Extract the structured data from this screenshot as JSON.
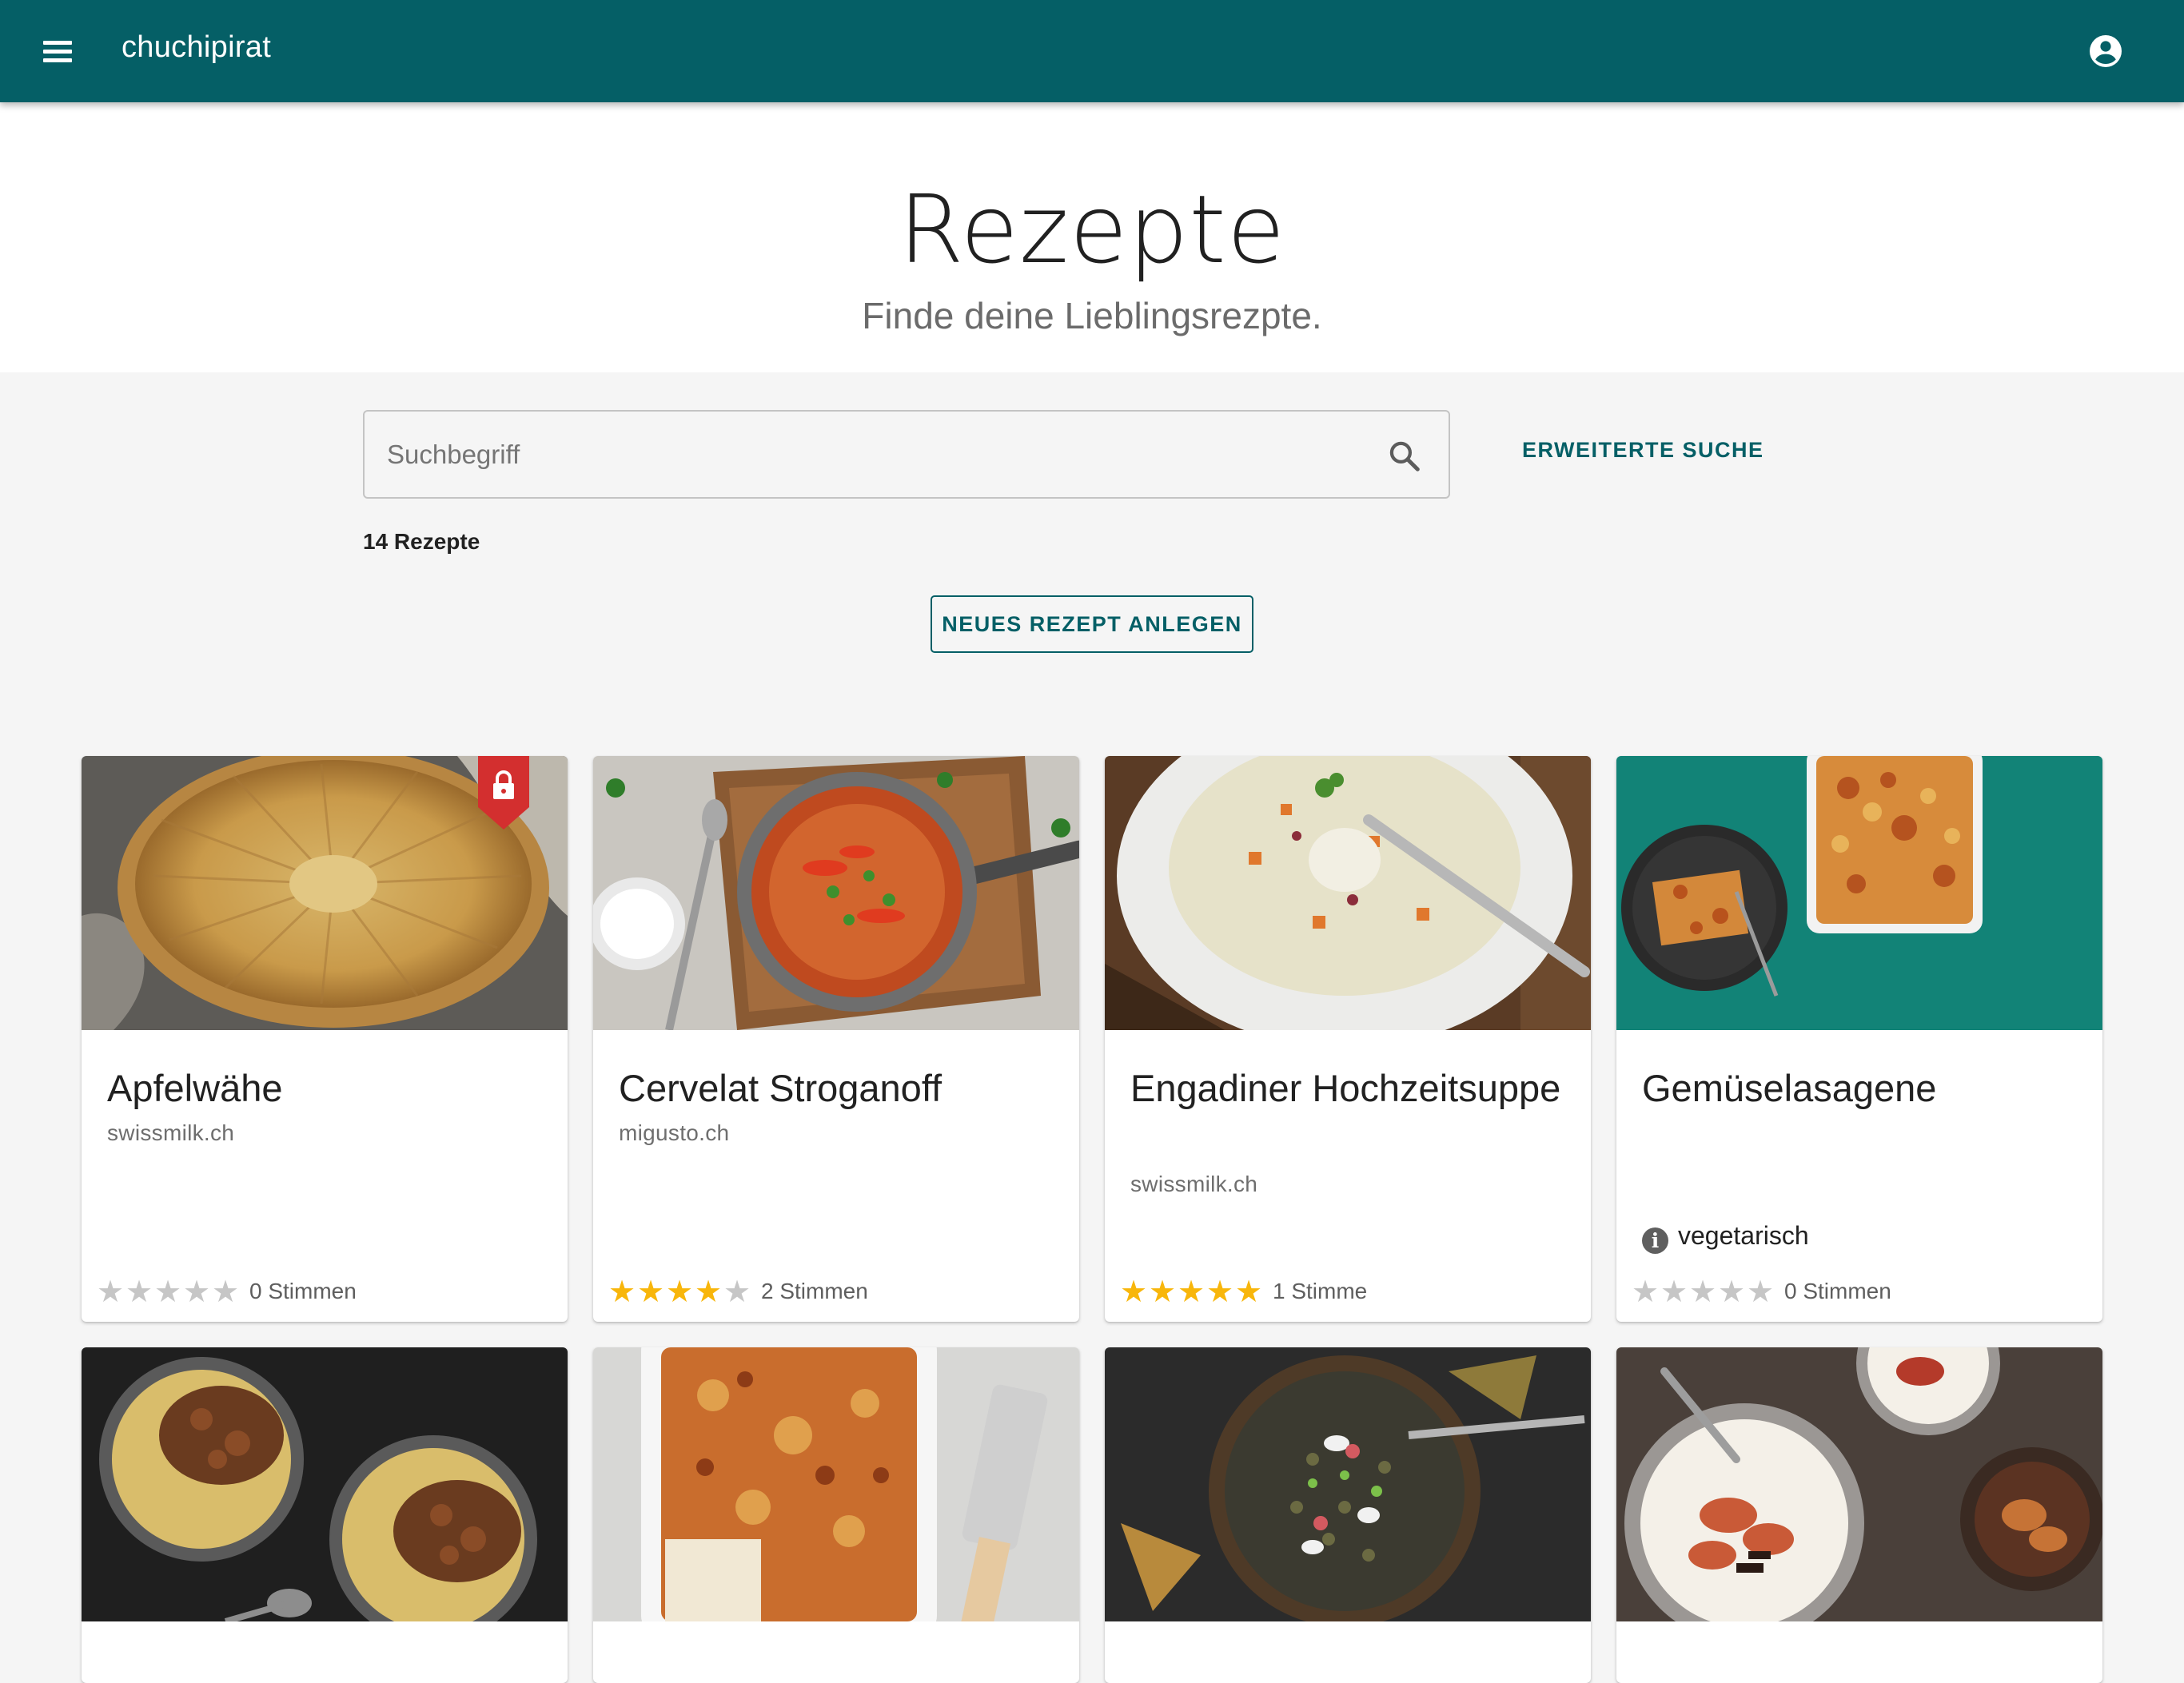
{
  "appbar": {
    "title": "chuchipirat",
    "menu_icon": "menu-icon",
    "account_icon": "account-circle-icon",
    "color": "#055f66"
  },
  "hero": {
    "title": "Rezepte",
    "subtitle": "Finde deine Lieblingsrezpte."
  },
  "search": {
    "placeholder": "Suchbegriff",
    "value": "",
    "icon": "search-icon",
    "advanced_label": "ERWEITERTE SUCHE"
  },
  "results": {
    "count_label": "14 Rezepte"
  },
  "actions": {
    "new_recipe_label": "NEUES REZEPT ANLEGEN"
  },
  "colors": {
    "accent": "#055f66",
    "star_active": "#f8b60b",
    "star_inactive": "#c6c6c6",
    "lock_badge": "#d32f2f"
  },
  "recipes": [
    {
      "title": "Apfelwähe",
      "source": "swissmilk.ch",
      "tag": "",
      "rating": 0,
      "votes_label": "0 Stimmen",
      "private": true,
      "image": "apple-tart"
    },
    {
      "title": "Cervelat Stroganoff",
      "source": "migusto.ch",
      "tag": "",
      "rating": 4,
      "votes_label": "2 Stimmen",
      "private": false,
      "image": "stroganoff-pan"
    },
    {
      "title": "Engadiner Hochzeitsuppe",
      "source": "swissmilk.ch",
      "tag": "",
      "rating": 5,
      "votes_label": "1 Stimme",
      "private": false,
      "image": "soup-bowl"
    },
    {
      "title": "Gemüselasagene",
      "source": "",
      "tag": "vegetarisch",
      "rating": 0,
      "votes_label": "0 Stimmen",
      "private": false,
      "image": "vegetable-lasagna"
    },
    {
      "title": "",
      "source": "",
      "tag": "",
      "rating": null,
      "votes_label": "",
      "private": false,
      "image": "pasta-with-mince"
    },
    {
      "title": "",
      "source": "",
      "tag": "",
      "rating": null,
      "votes_label": "",
      "private": false,
      "image": "lasagna-dish"
    },
    {
      "title": "",
      "source": "",
      "tag": "",
      "rating": null,
      "votes_label": "",
      "private": false,
      "image": "lentil-salad"
    },
    {
      "title": "",
      "source": "",
      "tag": "",
      "rating": null,
      "votes_label": "",
      "private": false,
      "image": "dessert-glasses"
    }
  ]
}
